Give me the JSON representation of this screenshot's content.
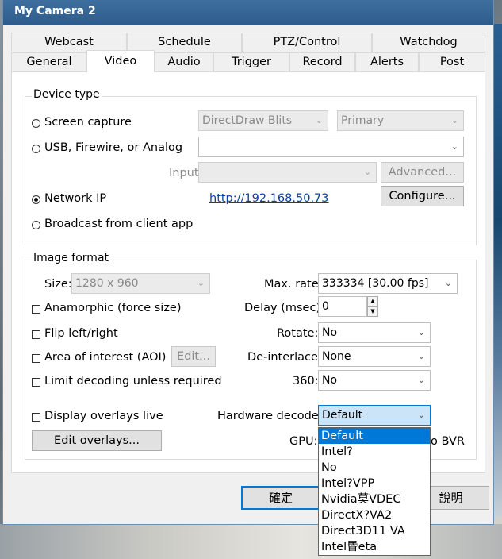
{
  "window": {
    "title": "My Camera 2"
  },
  "tabs": {
    "row1": [
      "Webcast",
      "Schedule",
      "PTZ/Control",
      "Watchdog"
    ],
    "row2": [
      "General",
      "Video",
      "Audio",
      "Trigger",
      "Record",
      "Alerts",
      "Post"
    ],
    "active": "Video"
  },
  "device_type": {
    "title": "Device type",
    "screen_capture": {
      "label": "Screen capture",
      "selected": false,
      "mode": "DirectDraw Blits",
      "monitor": "Primary"
    },
    "usb": {
      "label": "USB, Firewire, or Analog",
      "selected": false,
      "device": "",
      "input_label": "Input",
      "input": "",
      "advanced_label": "Advanced..."
    },
    "network_ip": {
      "label": "Network IP",
      "selected": true,
      "url": "http://192.168.50.73",
      "configure_label": "Configure..."
    },
    "broadcast": {
      "label": "Broadcast from client app",
      "selected": false
    }
  },
  "image_format": {
    "title": "Image format",
    "size_label": "Size:",
    "size_value": "1280 x 960",
    "max_rate_label": "Max. rate:",
    "max_rate_value": "333334 [30.00 fps]",
    "anamorphic_label": "Anamorphic (force size)",
    "delay_label": "Delay (msec):",
    "delay_value": "0",
    "flip_label": "Flip left/right",
    "rotate_label": "Rotate:",
    "rotate_value": "No",
    "aoi_label": "Area of interest (AOI)",
    "aoi_edit_label": "Edit...",
    "deinterlace_label": "De-interlace:",
    "deinterlace_value": "None",
    "limit_decoding_label": "Limit decoding unless required",
    "v360_label": "360:",
    "v360_value": "No",
    "overlays_live_label": "Display overlays live",
    "hw_decode_label": "Hardware decode:",
    "hw_decode_value": "Default",
    "edit_overlays_label": "Edit overlays...",
    "gpu_label": "GPU:",
    "gpu_trailing": "o BVR"
  },
  "hw_decode_options": [
    "Default",
    "Intel?",
    "No",
    "Intel?VPP",
    "Nvidia莫VDEC",
    "DirectX?VA2",
    "Direct3D11 VA",
    "Intel昬eta"
  ],
  "footer": {
    "ok_label": "確定",
    "help_label": "說明"
  }
}
